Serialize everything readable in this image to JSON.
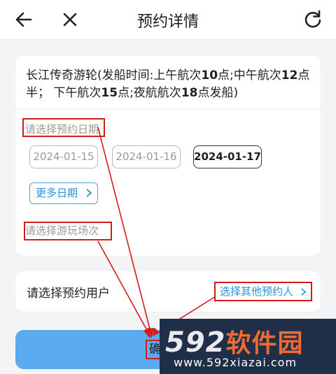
{
  "header": {
    "title": "预约详情",
    "back_icon": "arrow-left-icon",
    "close_icon": "close-icon",
    "refresh_icon": "refresh-icon"
  },
  "ship": {
    "name": "长江传奇游轮",
    "schedule_prefix": "(发船时间:上午航次",
    "h1": "10",
    "mid1": "点;中午航次",
    "h2": "12",
    "mid2": "点半； 下午航次",
    "h3": "15",
    "mid3": "点;夜航航次",
    "h4": "18",
    "suffix": "点发船)"
  },
  "date_section": {
    "hint": "请选择预约日期",
    "dates": [
      "2024-01-15",
      "2024-01-16",
      "2024-01-17"
    ],
    "selected_date": "2024-01-17",
    "more_label": "更多日期"
  },
  "session_section": {
    "hint": "请选择游玩场次"
  },
  "user_section": {
    "label": "请选择预约用户",
    "other_link": "选择其他预约人"
  },
  "confirm": {
    "label": "确"
  },
  "watermark": {
    "logo_num": "592",
    "logo_cn": "软件园",
    "url": "www.592xiazai.com"
  },
  "colors": {
    "accent": "#2d8fd5",
    "annotation_red": "#d61b1b",
    "confirm_bg": "#5aabf0"
  }
}
